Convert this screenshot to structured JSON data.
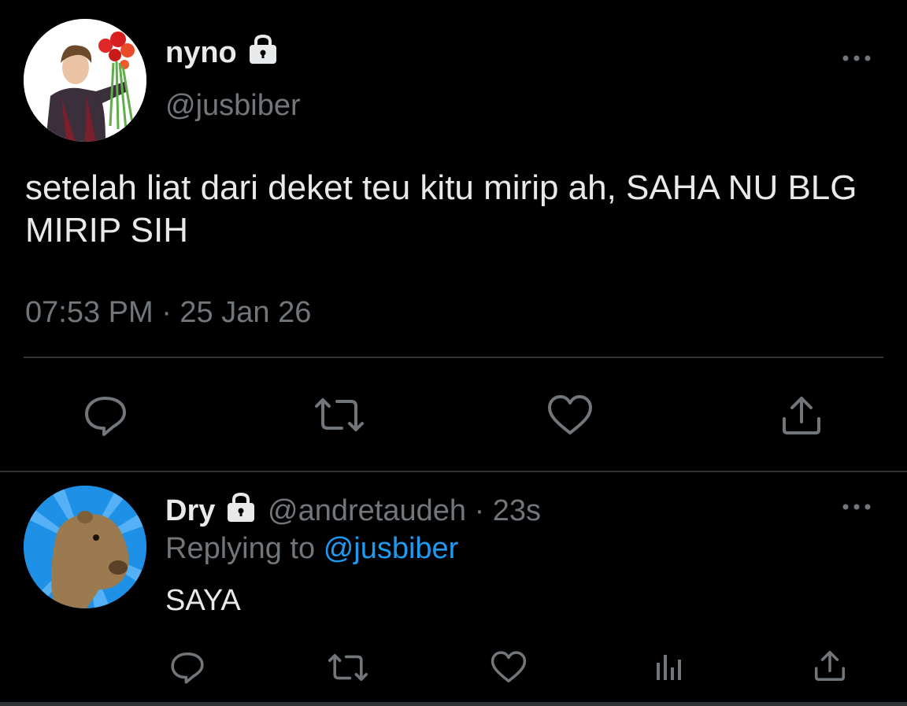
{
  "main_tweet": {
    "author_name": "nyno",
    "author_handle": "@jusbiber",
    "text": "setelah liat dari deket teu kitu mirip ah, SAHA NU BLG MIRIP SIH",
    "timestamp": "07:53 PM · 25 Jan 26",
    "actions": [
      "reply-icon",
      "retweet-icon",
      "like-icon",
      "share-icon"
    ]
  },
  "reply": {
    "author_name": "Dry",
    "author_handle": "@andretaudeh",
    "separator": "·",
    "time_ago": "23s",
    "replying_prefix": "Replying to",
    "replying_to": "@jusbiber",
    "text": "SAYA",
    "actions": [
      "reply-icon",
      "retweet-icon",
      "like-icon",
      "analytics-icon",
      "share-icon"
    ]
  },
  "colors": {
    "background": "#000000",
    "primary_text": "#e7e9ea",
    "secondary_text": "#71767b",
    "link": "#1d9bf0",
    "divider": "#2f3336"
  }
}
